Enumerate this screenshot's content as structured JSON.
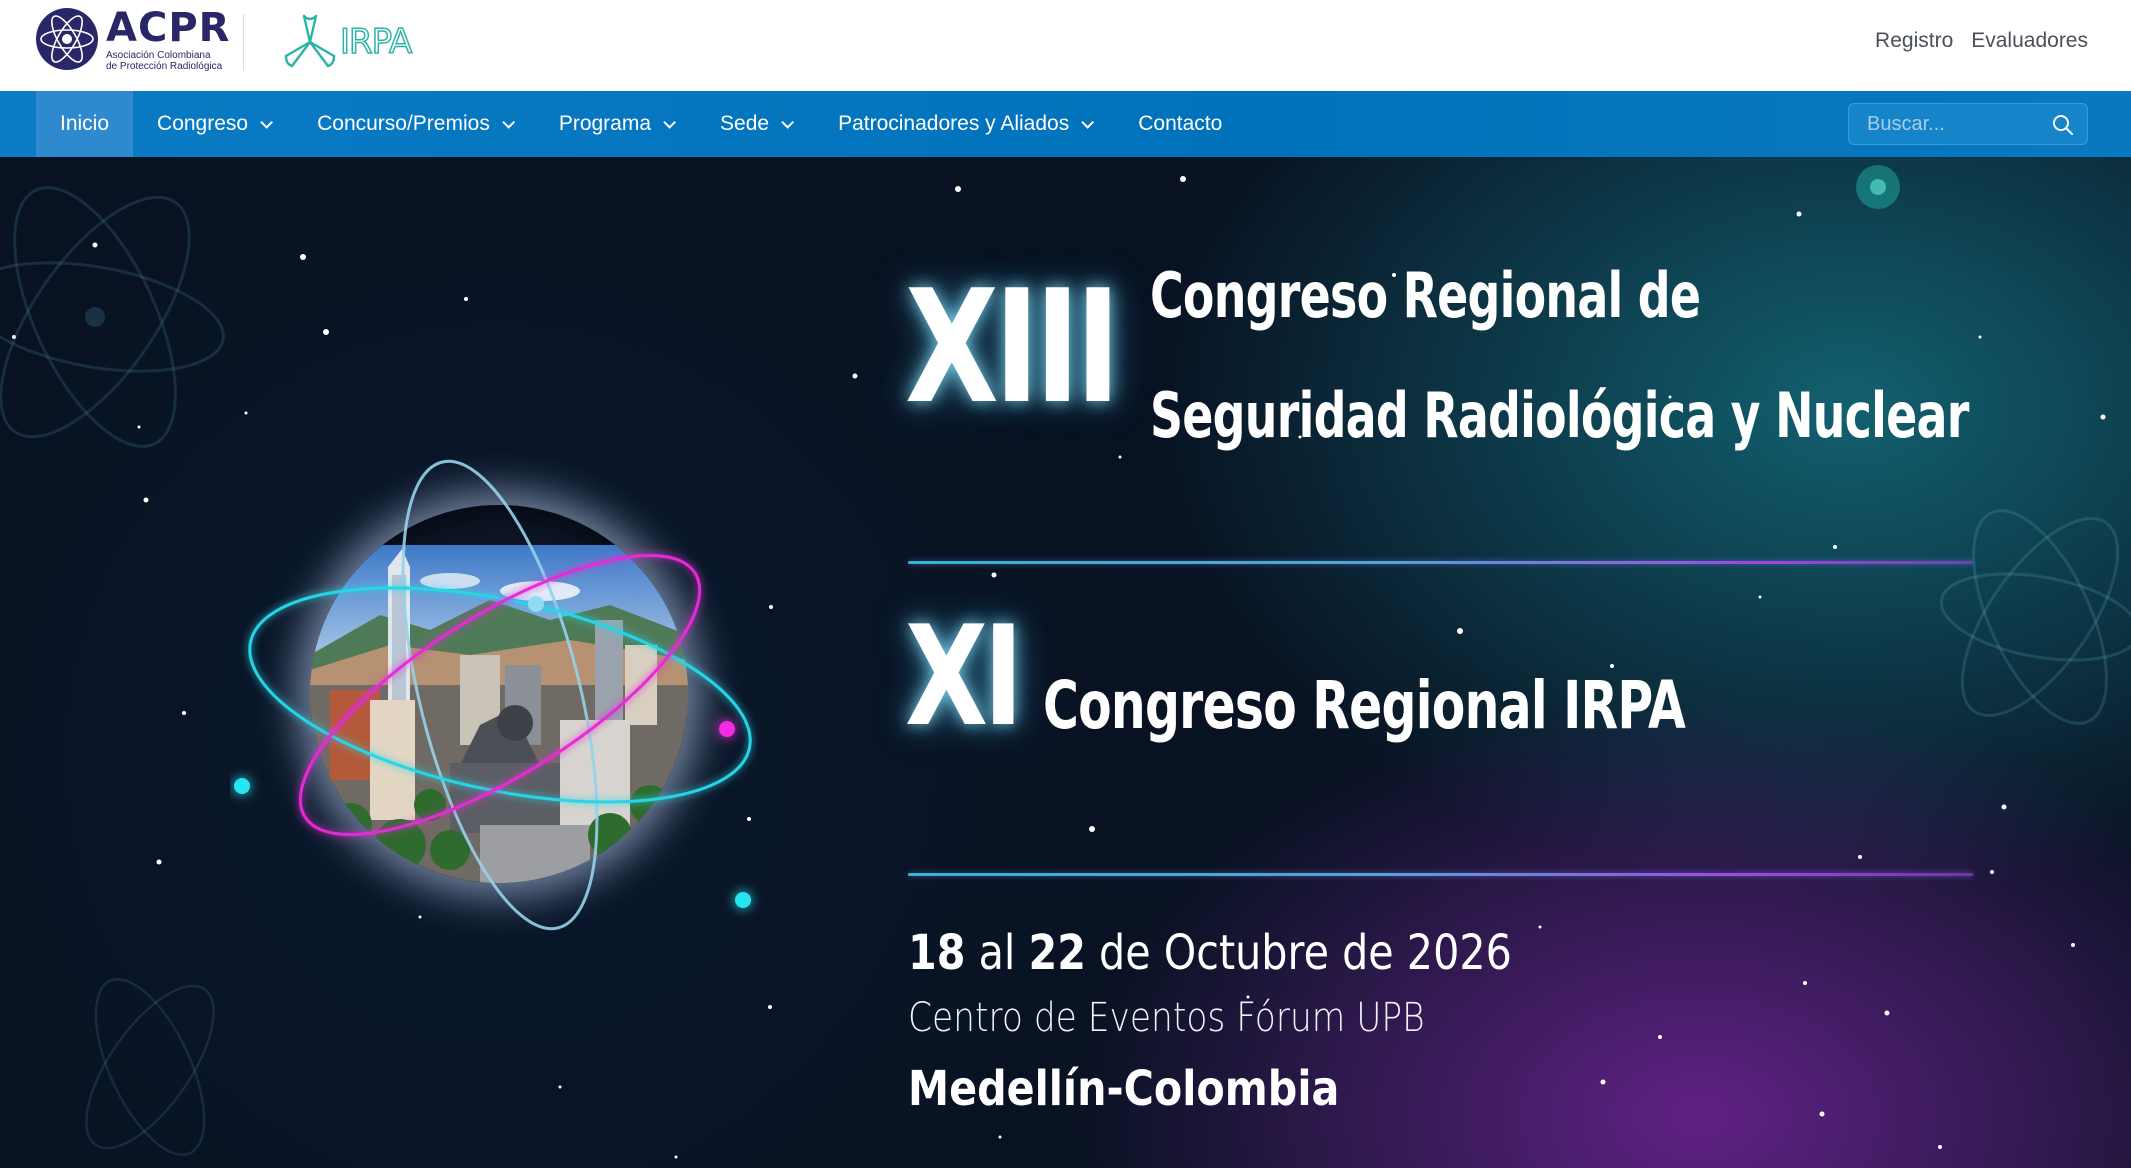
{
  "header": {
    "acpr_logo": {
      "name": "ACPR",
      "subtitle_line1": "Asociación Colombiana",
      "subtitle_line2": "de Protección Radiológica"
    },
    "irpa_logo": {
      "name": "IRPA"
    },
    "utility_links": [
      "Registro",
      "Evaluadores"
    ]
  },
  "nav": {
    "items": [
      {
        "label": "Inicio",
        "active": true,
        "dropdown": false
      },
      {
        "label": "Congreso",
        "active": false,
        "dropdown": true
      },
      {
        "label": "Concurso/Premios",
        "active": false,
        "dropdown": true
      },
      {
        "label": "Programa",
        "active": false,
        "dropdown": true
      },
      {
        "label": "Sede",
        "active": false,
        "dropdown": true
      },
      {
        "label": "Patrocinadores y Aliados",
        "active": false,
        "dropdown": true
      },
      {
        "label": "Contacto",
        "active": false,
        "dropdown": false
      }
    ],
    "search": {
      "placeholder": "Buscar...",
      "value": ""
    }
  },
  "hero": {
    "roman_1": "XIII",
    "title_1_line1": "Congreso Regional de",
    "title_1_line2": "Seguridad Radiológica y Nuclear",
    "roman_2": "XI",
    "title_2": "Congreso Regional IRPA",
    "date": {
      "day_start": "18",
      "connector_1": "al",
      "day_end": "22",
      "connector_2": "de Octubre de 2026"
    },
    "venue": "Centro de Eventos Fórum UPB",
    "city": "Medellín-Colombia"
  },
  "colors": {
    "brand_navy": "#2a2768",
    "irpa_teal": "#2bb3a8",
    "nav_blue": "#0072bb",
    "nav_active": "#2f89cf",
    "orbit_cyan": "#27d6e6",
    "orbit_magenta": "#e62bd6"
  }
}
